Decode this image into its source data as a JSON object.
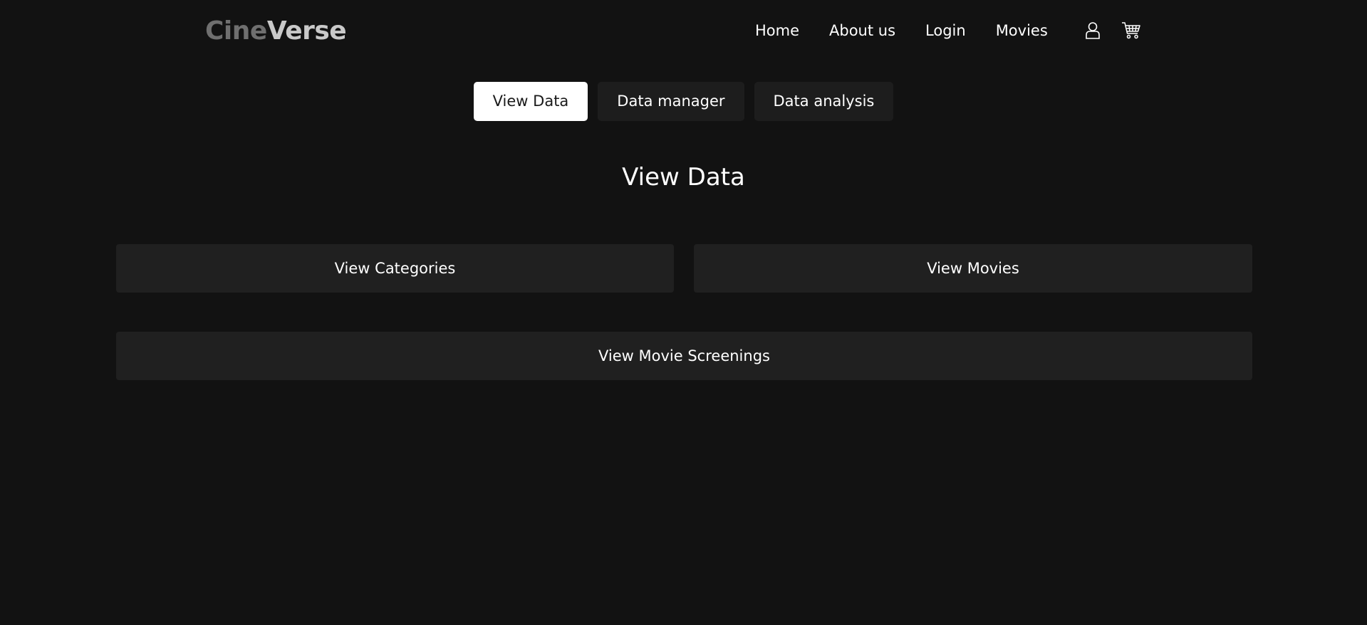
{
  "brand": {
    "part1": "Cine",
    "part2": "Verse"
  },
  "nav": {
    "items": [
      {
        "label": "Home"
      },
      {
        "label": "About us"
      },
      {
        "label": "Login"
      },
      {
        "label": "Movies"
      }
    ],
    "icons": [
      "user-icon",
      "cart-icon"
    ]
  },
  "tabs": [
    {
      "label": "View Data",
      "active": true
    },
    {
      "label": "Data manager",
      "active": false
    },
    {
      "label": "Data analysis",
      "active": false
    }
  ],
  "page": {
    "title": "View Data"
  },
  "cards": {
    "categories": "View Categories",
    "movies": "View Movies",
    "screenings": "View Movie Screenings"
  },
  "colors": {
    "background": "#121212",
    "surface": "#202020",
    "active_tab": "#ffffff",
    "logo_dim": "#6f6f6f",
    "logo_bright": "#c9c9c9"
  }
}
